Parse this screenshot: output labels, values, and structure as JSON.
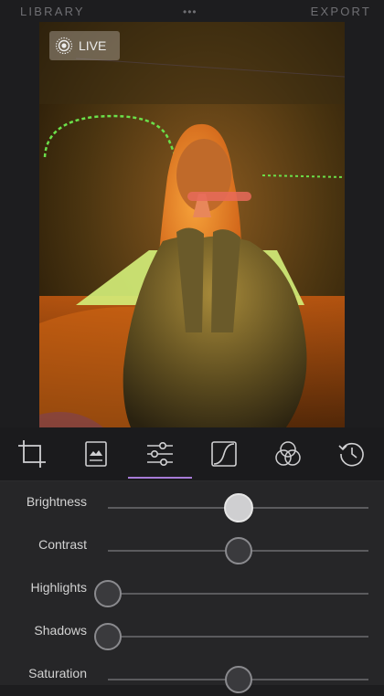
{
  "header": {
    "library_label": "LIBRARY",
    "more_label": "•••",
    "export_label": "EXPORT"
  },
  "photo": {
    "live_label": "LIVE"
  },
  "tools": [
    {
      "name": "crop-tool",
      "icon": "crop-icon"
    },
    {
      "name": "filters-tool",
      "icon": "filters-icon"
    },
    {
      "name": "adjust-tool",
      "icon": "sliders-icon",
      "selected": true
    },
    {
      "name": "curves-tool",
      "icon": "curves-icon"
    },
    {
      "name": "color-tool",
      "icon": "color-circles-icon"
    },
    {
      "name": "history-tool",
      "icon": "history-icon"
    }
  ],
  "adjustments": [
    {
      "label": "Brightness",
      "value": 0.5,
      "active": true
    },
    {
      "label": "Contrast",
      "value": 0.5
    },
    {
      "label": "Highlights",
      "value": 0.0
    },
    {
      "label": "Shadows",
      "value": 0.0
    },
    {
      "label": "Saturation",
      "value": 0.5
    }
  ],
  "colors": {
    "background": "#1d1d1f",
    "accent": "#a77bd8",
    "neon_green": "#6be04a"
  }
}
